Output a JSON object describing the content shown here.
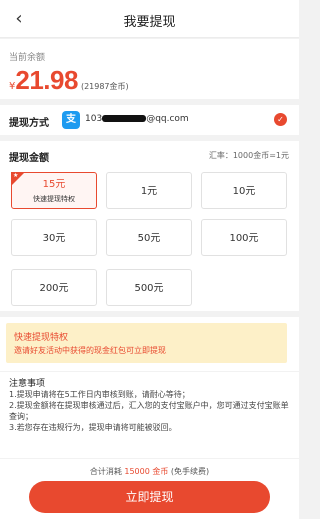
{
  "header": {
    "back_icon": "chevron-left-icon",
    "title": "我要提现"
  },
  "balance": {
    "label": "当前余额",
    "currency": "¥",
    "amount": "21.98",
    "coins": "(21987金币)"
  },
  "method": {
    "label": "提现方式",
    "icon": "alipay-icon",
    "account_prefix": "103",
    "account_suffix": "@qq.com",
    "selected": true
  },
  "amount": {
    "label": "提现金额",
    "rate": "汇率：1000金币=1元",
    "options": [
      {
        "value": "15元",
        "sub": "快速提现特权",
        "selected": true
      },
      {
        "value": "1元"
      },
      {
        "value": "10元"
      },
      {
        "value": "30元"
      },
      {
        "value": "50元"
      },
      {
        "value": "100元"
      },
      {
        "value": "200元"
      },
      {
        "value": "500元"
      }
    ]
  },
  "privilege": {
    "title": "快速提现特权",
    "desc": "邀请好友活动中获得的现金红包可立即提现"
  },
  "notes": {
    "title": "注意事项",
    "items": [
      "1.提现申请将在5工作日内审核到账，请耐心等待；",
      "2.提现金额将在提现审核通过后，汇入您的支付宝账户中，您可通过支付宝账单查询；",
      "3.若您存在违规行为，提现申请将可能被驳回。"
    ]
  },
  "footer": {
    "cost_prefix": "合计消耗",
    "cost_value": "15000 金币",
    "cost_suffix": "(免手续费)",
    "submit": "立即提现"
  },
  "colors": {
    "accent": "#e8492f",
    "notice_bg": "#fdf0c8",
    "alipay": "#1e9bf0"
  }
}
